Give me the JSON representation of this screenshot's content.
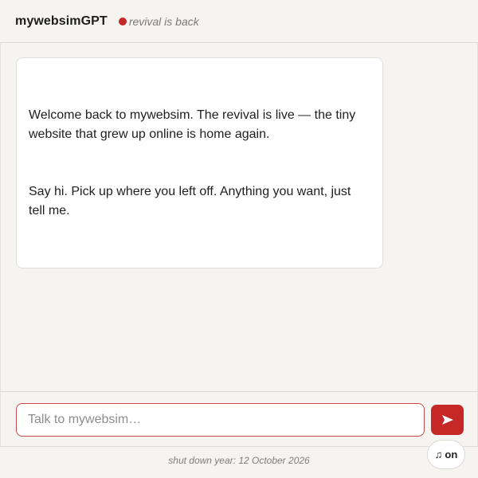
{
  "header": {
    "title": "mywebsimGPT",
    "status_text": "revival is back",
    "status_color": "#c62828"
  },
  "chat": {
    "messages": [
      {
        "role": "assistant",
        "paragraphs": [
          "Welcome back to mywebsim. The revival is live — the tiny website that grew up online is home again.",
          "Say hi. Pick up where you left off. Anything you want, just tell me."
        ]
      }
    ]
  },
  "composer": {
    "placeholder": "Talk to mywebsim…",
    "value": "",
    "send_icon": "send-arrow-icon",
    "accent_color": "#c62828"
  },
  "footer": {
    "text": "shut down year: 12 October 2026",
    "music_icon": "music-note-icon",
    "music_note_glyph": "♫",
    "music_label": "on"
  }
}
